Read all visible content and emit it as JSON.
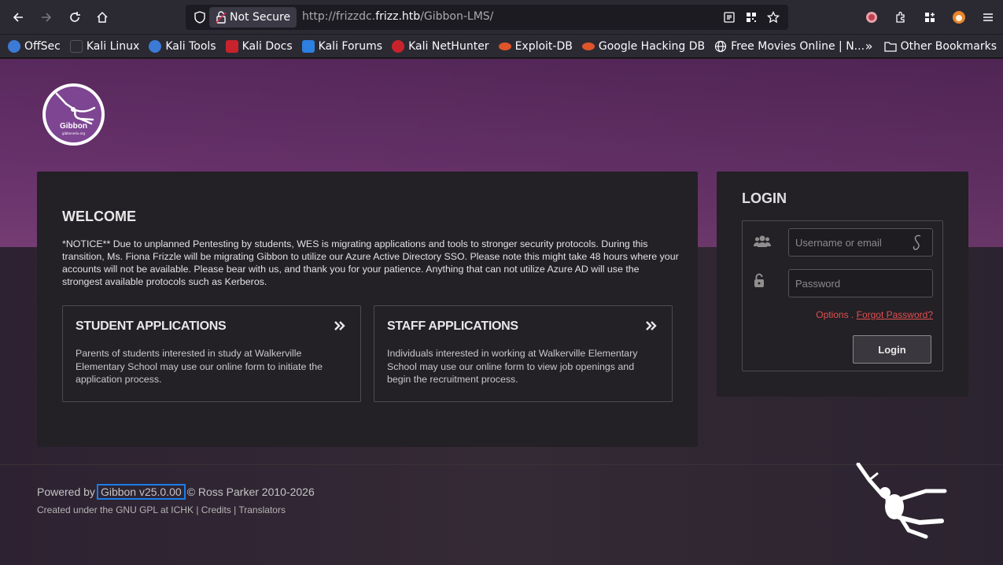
{
  "browser": {
    "security_label": "Not Secure",
    "url_prefix": "http://frizzdc.",
    "url_domain": "frizz.htb",
    "url_path": "/Gibbon-LMS/"
  },
  "bookmarks": [
    {
      "label": "OffSec",
      "color": "#3b7bd6"
    },
    {
      "label": "Kali Linux",
      "color": "#222"
    },
    {
      "label": "Kali Tools",
      "color": "#3b7bd6"
    },
    {
      "label": "Kali Docs",
      "color": "#c8232c"
    },
    {
      "label": "Kali Forums",
      "color": "#2d7fe0"
    },
    {
      "label": "Kali NetHunter",
      "color": "#c8232c"
    },
    {
      "label": "Exploit-DB",
      "color": "#e0542a"
    },
    {
      "label": "Google Hacking DB",
      "color": "#e0542a"
    },
    {
      "label": "Free Movies Online | N...",
      "color": "#ffffff"
    }
  ],
  "other_bookmarks": "Other Bookmarks",
  "logo": {
    "title": "Gibbon",
    "sub": "gibbonedu.org"
  },
  "welcome": {
    "title": "WELCOME",
    "notice": "*NOTICE** Due to unplanned Pentesting by students, WES is migrating applications and tools to stronger security protocols. During this transition, Ms. Fiona Frizzle will be migrating Gibbon to utilize our Azure Active Directory SSO. Please note this might take 48 hours where your accounts will not be available. Please bear with us, and thank you for your patience. Anything that can not utilize Azure AD will use the strongest available protocols such as Kerberos."
  },
  "cards": {
    "student": {
      "title": "STUDENT APPLICATIONS",
      "text": "Parents of students interested in study at Walkerville Elementary School may use our online form to initiate the application process."
    },
    "staff": {
      "title": "STAFF APPLICATIONS",
      "text": "Individuals interested in working at Walkerville Elementary School may use our online form to view job openings and begin the recruitment process."
    }
  },
  "login": {
    "title": "LOGIN",
    "username_placeholder": "Username or email",
    "password_placeholder": "Password",
    "options": "Options",
    "forgot": "Forgot Password?",
    "button": "Login"
  },
  "footer": {
    "powered_by": "Powered by",
    "version": "Gibbon v25.0.00",
    "copyright": "© Ross Parker 2010-2026",
    "created": "Created under the GNU GPL at ICHK",
    "credits": "Credits",
    "translators": "Translators"
  }
}
